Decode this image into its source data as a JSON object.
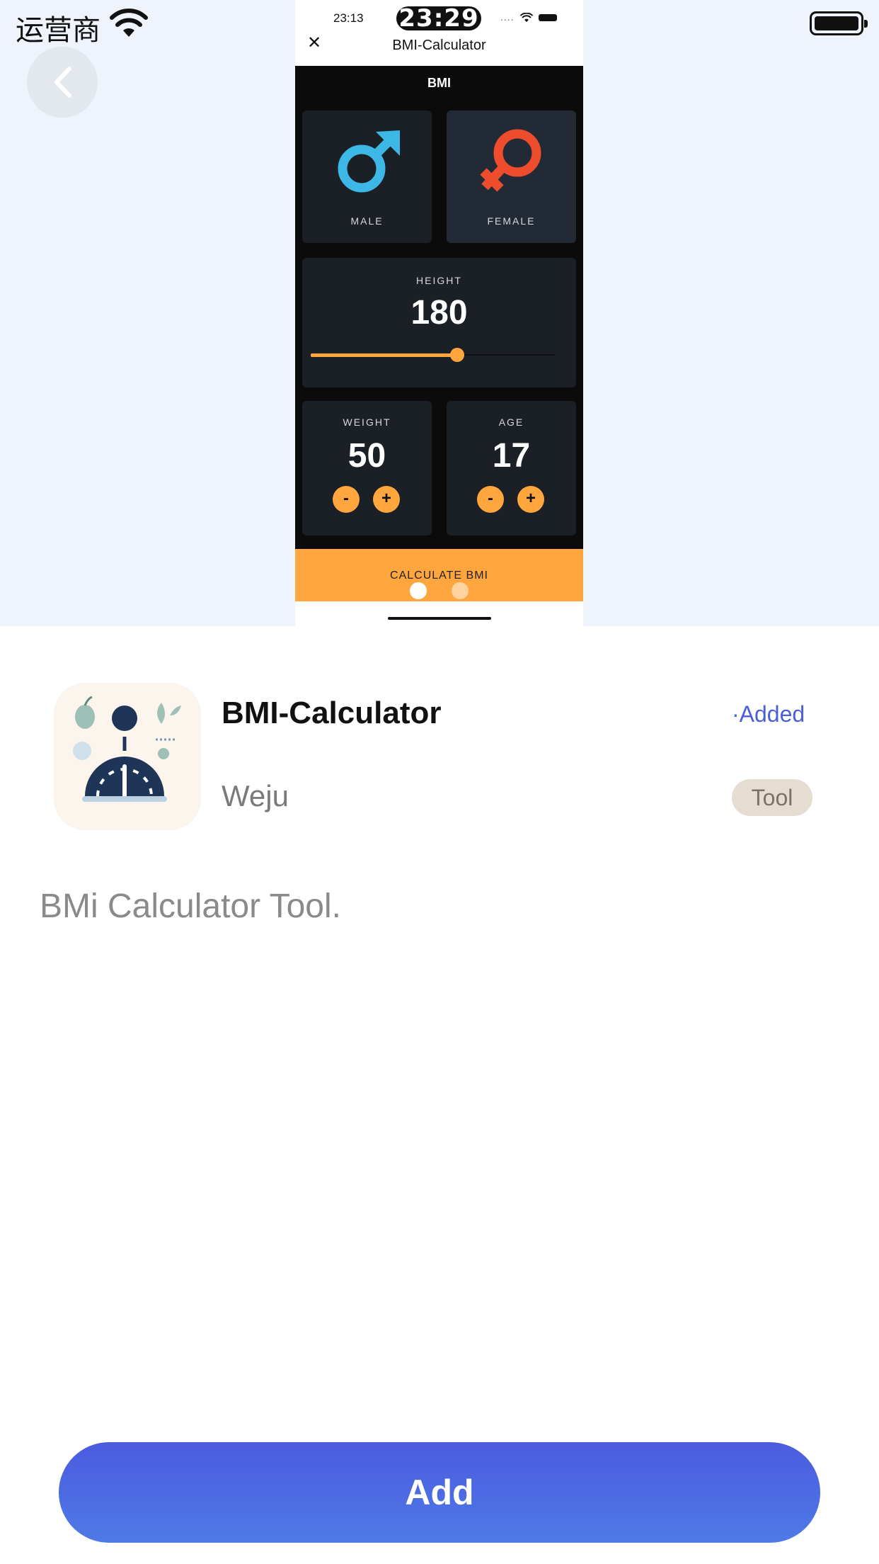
{
  "status_bar": {
    "carrier": "运营商"
  },
  "preview": {
    "time": "23:13",
    "clock": "23:29",
    "signal_dots": "....",
    "title": "BMI-Calculator",
    "header": "BMI",
    "gender": {
      "male": "MALE",
      "female": "FEMALE"
    },
    "height": {
      "label": "HEIGHT",
      "value": "180",
      "slider_fraction": 0.6
    },
    "weight": {
      "label": "WEIGHT",
      "value": "50"
    },
    "age": {
      "label": "AGE",
      "value": "17"
    },
    "minus": "-",
    "plus": "+",
    "calculate": "CALCULATE BMI"
  },
  "app": {
    "name": "BMI-Calculator",
    "status": "·Added",
    "developer": "Weju",
    "category": "Tool",
    "description": "BMi Calculator Tool."
  },
  "add_button": "Add",
  "colors": {
    "accent": "#ffa63e",
    "male": "#3cb7e6",
    "female": "#ee4d2d",
    "primary": "#4a5fdf"
  }
}
